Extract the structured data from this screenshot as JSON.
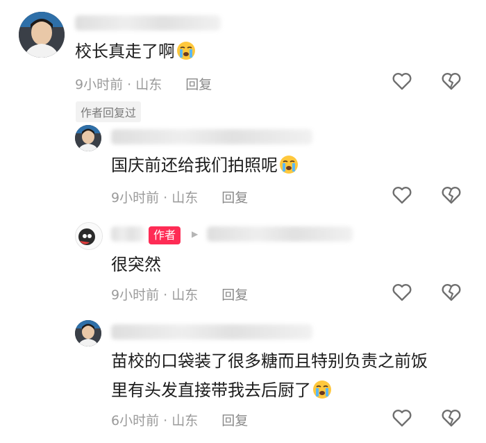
{
  "comments": [
    {
      "text": "校长真走了啊",
      "time": "9小时前",
      "location": "山东",
      "reply": "回复",
      "dot": "·"
    },
    {
      "text": "国庆前还给我们拍照呢",
      "time": "9小时前",
      "location": "山东",
      "reply": "回复",
      "dot": "·"
    },
    {
      "text": "很突然",
      "time": "9小时前",
      "location": "山东",
      "reply": "回复",
      "dot": "·"
    },
    {
      "text_line1": "苗校的口袋装了很多糖而且特别负责之前饭",
      "text_line2": "里有头发直接带我去后厨了",
      "time": "6小时前",
      "location": "山东",
      "reply": "回复",
      "dot": "·"
    }
  ],
  "replied_badge": "作者回复过",
  "author_badge": "作者",
  "colors": {
    "accent": "#fe2c55",
    "meta": "#9a9a9a",
    "icon": "#6f6f6f"
  }
}
